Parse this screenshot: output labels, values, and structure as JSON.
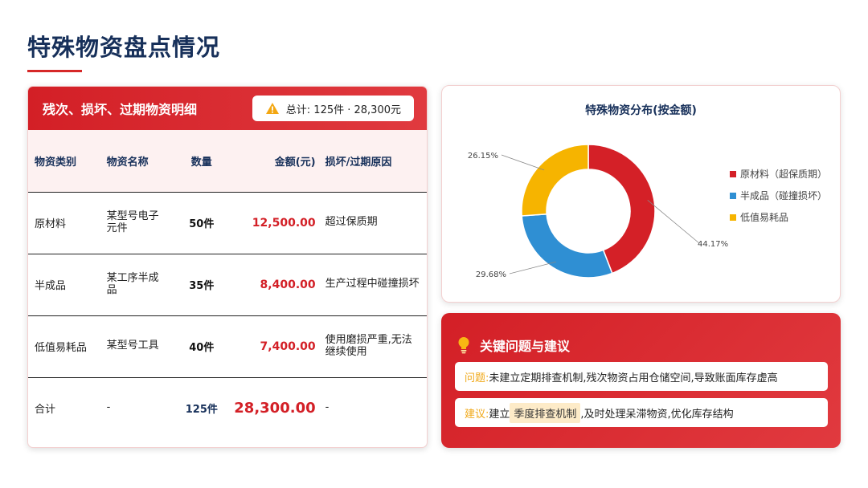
{
  "page": {
    "title": "特殊物资盘点情况"
  },
  "table_card": {
    "title": "残次、损坏、过期物资明细",
    "total_badge": "总计: 125件 · 28,300元",
    "columns": [
      "物资类别",
      "物资名称",
      "数量",
      "金额(元)",
      "损坏/过期原因"
    ],
    "rows": [
      {
        "category": "原材料",
        "name": "某型号电子元件",
        "qty": "50件",
        "amount": "12,500.00",
        "reason": "超过保质期"
      },
      {
        "category": "半成品",
        "name": "某工序半成品",
        "qty": "35件",
        "amount": "8,400.00",
        "reason": "生产过程中碰撞损坏"
      },
      {
        "category": "低值易耗品",
        "name": "某型号工具",
        "qty": "40件",
        "amount": "7,400.00",
        "reason": "使用磨损严重,无法继续使用"
      },
      {
        "category": "合计",
        "name": "-",
        "qty": "125件",
        "amount": "28,300.00",
        "reason": "-"
      }
    ]
  },
  "chart_data": {
    "type": "pie",
    "title": "特殊物资分布(按金额)",
    "categories": [
      "原材料（超保质期）",
      "半成品（碰撞损坏）",
      "低值易耗品"
    ],
    "values": [
      44.17,
      29.68,
      26.15
    ],
    "labels": [
      "44.17%",
      "29.68%",
      "26.15%"
    ],
    "colors": [
      "#d42027",
      "#2f8fd3",
      "#f6b400"
    ],
    "donut": true,
    "legend_position": "right"
  },
  "issues": {
    "title": "关键问题与建议",
    "problem_label": "问题:",
    "problem_text": "未建立定期排查机制,残次物资占用仓储空间,导致账面库存虚高",
    "suggest_label": "建议:",
    "suggest_pre": "建立",
    "suggest_highlight": "季度排查机制",
    "suggest_post": ",及时处理呆滞物资,优化库存结构"
  },
  "icons": {
    "warning": "warning-icon",
    "bulb": "lightbulb-icon"
  },
  "colors": {
    "brand_red": "#d31f26",
    "navy": "#17305a",
    "accent_yellow": "#f0a818"
  }
}
